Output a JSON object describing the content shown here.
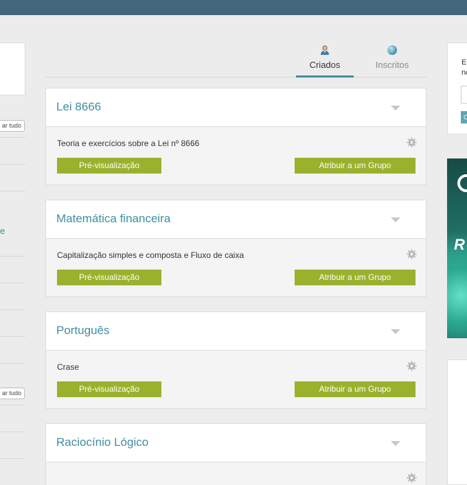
{
  "tabs": [
    {
      "label": "Criados",
      "icon": "user-icon",
      "active": true
    },
    {
      "label": "Inscritos",
      "icon": "globe-icon",
      "active": false
    }
  ],
  "cards": [
    {
      "title": "Lei 8666",
      "description": "Teoria e exercícios sobre a Lei nº 8666",
      "preview_label": "Pré-visualização",
      "assign_label": "Atribuir a um Grupo"
    },
    {
      "title": "Matemática financeira",
      "description": "Capitalização simples e composta e Fluxo de caixa",
      "preview_label": "Pré-visualização",
      "assign_label": "Atribuir a um Grupo"
    },
    {
      "title": "Português",
      "description": "Crase",
      "preview_label": "Pré-visualização",
      "assign_label": "Atribuir a um Grupo"
    },
    {
      "title": "Raciocínio Lógico",
      "description": "",
      "preview_label": "",
      "assign_label": ""
    }
  ],
  "left_sidebar": {
    "button_fragment": "ar tudo",
    "link_fragment": "e"
  },
  "right_sidebar": {
    "text_line1": "Er",
    "text_line2": "no",
    "button_fragment": "C",
    "banner_text": "R"
  },
  "colors": {
    "topbar": "#44677c",
    "accent": "#3f8ea0",
    "button": "#9ab12e"
  }
}
